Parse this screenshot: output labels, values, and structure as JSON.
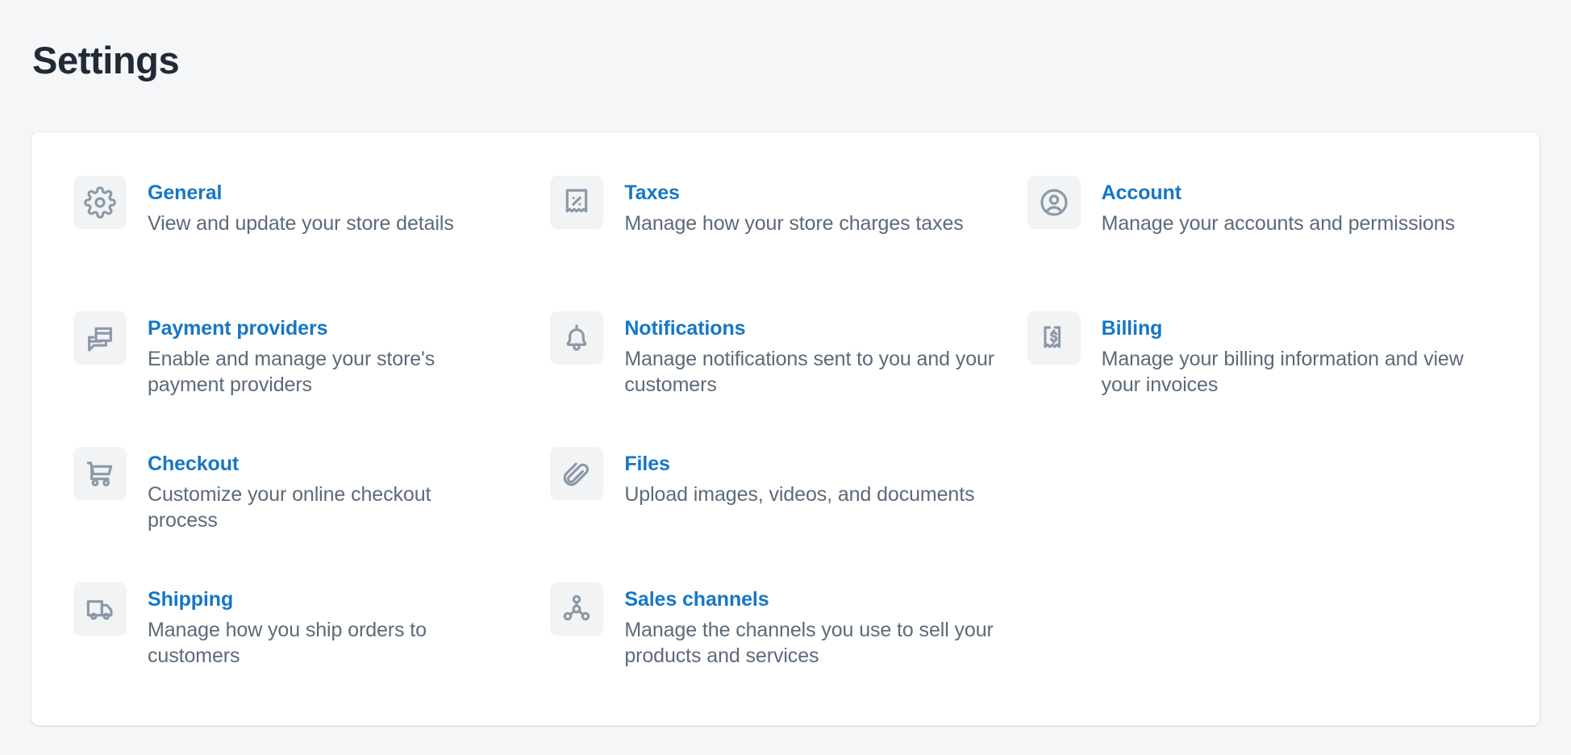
{
  "header": {
    "title": "Settings"
  },
  "settings": {
    "items": [
      {
        "icon": "gear-icon",
        "title": "General",
        "description": "View and update your store details"
      },
      {
        "icon": "receipt-percent-icon",
        "title": "Taxes",
        "description": "Manage how your store charges taxes"
      },
      {
        "icon": "account-circle-icon",
        "title": "Account",
        "description": "Manage your accounts and permissions"
      },
      {
        "icon": "credit-cards-icon",
        "title": "Payment providers",
        "description": "Enable and manage your store's payment providers"
      },
      {
        "icon": "bell-icon",
        "title": "Notifications",
        "description": "Manage notifications sent to you and your customers"
      },
      {
        "icon": "receipt-dollar-icon",
        "title": "Billing",
        "description": "Manage your billing information and view your invoices"
      },
      {
        "icon": "shopping-cart-icon",
        "title": "Checkout",
        "description": "Customize your online checkout process"
      },
      {
        "icon": "paperclip-icon",
        "title": "Files",
        "description": "Upload images, videos, and documents"
      },
      {
        "icon": "truck-icon",
        "title": "Shipping",
        "description": "Manage how you ship orders to customers"
      },
      {
        "icon": "network-nodes-icon",
        "title": "Sales channels",
        "description": "Manage the channels you use to sell your products and services"
      }
    ]
  },
  "colors": {
    "page_background": "#f4f6f8",
    "card_background": "#ffffff",
    "title_text": "#212b36",
    "link_blue": "#1677c4",
    "description_text": "#5c6a7a",
    "icon_gray": "#8c99a8",
    "icon_box_background": "#f1f3f5"
  }
}
